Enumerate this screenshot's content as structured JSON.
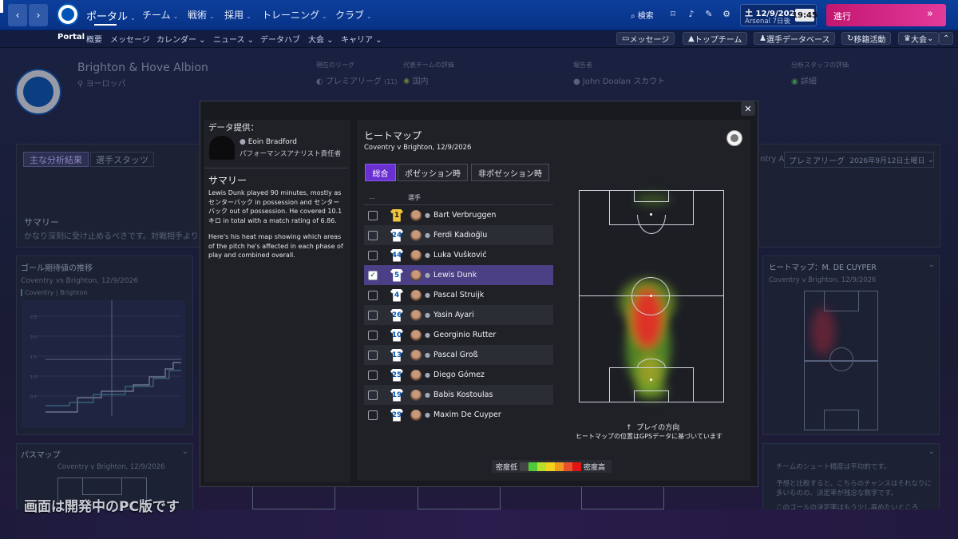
{
  "topbar": {
    "back_icon": "chevron-left",
    "forward_icon": "chevron-right",
    "nav": [
      "ポータル",
      "チーム",
      "戦術",
      "採用",
      "トレーニング",
      "クラブ"
    ],
    "search_label": "検索",
    "date": "土 12/9/2026",
    "next_match": "Arsenal 7日後",
    "time": "19:45",
    "continue_label": "進行",
    "continue_icon": "double-chevron-right"
  },
  "subnav": {
    "portal": "Portal",
    "items": [
      "概要",
      "メッセージ",
      "カレンダー",
      "ニュース",
      "データハブ",
      "大会",
      "キャリア"
    ],
    "right_buttons": [
      "メッセージ",
      "トップチーム",
      "選手データベース",
      "移籍活動",
      "大会"
    ]
  },
  "club": {
    "name": "Brighton & Hove Albion",
    "region": "ヨーロッパ",
    "current_league_label": "現在のリーグ",
    "current_league": "プレミアリーグ",
    "league_rank": "(11)",
    "rep_label": "代表チームの評価",
    "rep_value": "国内",
    "reporter_label": "報告者",
    "reporter": "John Doolan スカウト",
    "analyst_eval_label": "分析スタッフの評価",
    "analyst_eval": "詳細"
  },
  "background": {
    "tabs": [
      "主な分析結果",
      "選手スタッツ"
    ],
    "summary_title": "サマリー",
    "summary_text": "かなり深刻に受け止めるべきです。対戦相手より",
    "filter_left": "ntry A",
    "filter_league": "プレミアリーグ",
    "filter_date": "2026年9月12日土曜日",
    "xg_title": "ゴール期待値の推移",
    "xg_match": "Coventry vs Brighton, 12/9/2026",
    "xg_legend": [
      "Coventry",
      "Brighton"
    ],
    "pass_title": "パスマップ",
    "pass_match": "Coventry v Brighton, 12/9/2026",
    "right_heat_title": "ヒートマップ：M. DE CUYPER",
    "right_heat_match": "Coventry v Brighton, 12/9/2026",
    "shot_text1": "チームのシュート精度は平均的です。",
    "shot_text2": "予想と比較すると、こちらのチャンスはそれなりに多いものの、決定率が残念な数字です。",
    "shot_text3": "このゴールの決定率はもう少し高めたいところ",
    "watermark": "画面は開発中のPC版です"
  },
  "modal": {
    "provider_label": "データ提供：",
    "analyst_name": "Eoin Bradford",
    "analyst_role": "パフォーマンスアナリスト責任者",
    "summary_title": "サマリー",
    "summary_p1": "Lewis Dunk played 90 minutes, mostly as センターバック in possession and センターバック out of possession. He covered 10.1キロ in total with a match rating of 6.86.",
    "summary_p2": "Here's his heat map showing which areas of the pitch he's affected in each phase of play and combined overall.",
    "heatmap_title": "ヒートマップ",
    "match": "Coventry v Brighton, 12/9/2026",
    "tabs": [
      "総合",
      "ポゼッション時",
      "非ポゼッション時"
    ],
    "col_more": "...",
    "col_player": "選手",
    "players": [
      {
        "number": "1",
        "name": "Bart Verbruggen",
        "checked": false,
        "gk": true
      },
      {
        "number": "24",
        "name": "Ferdi Kadıoğlu",
        "checked": false
      },
      {
        "number": "44",
        "name": "Luka Vušković",
        "checked": false
      },
      {
        "number": "5",
        "name": "Lewis Dunk",
        "checked": true
      },
      {
        "number": "4",
        "name": "Pascal Struijk",
        "checked": false
      },
      {
        "number": "26",
        "name": "Yasin Ayari",
        "checked": false
      },
      {
        "number": "10",
        "name": "Georginio Rutter",
        "checked": false
      },
      {
        "number": "13",
        "name": "Pascal Groß",
        "checked": false
      },
      {
        "number": "25",
        "name": "Diego Gómez",
        "checked": false
      },
      {
        "number": "19",
        "name": "Babis Kostoulas",
        "checked": false
      },
      {
        "number": "29",
        "name": "Maxim De Cuyper",
        "checked": false
      }
    ],
    "direction_label": "プレイの方向",
    "gps_note": "ヒートマップの位置はGPSデータに基づいています",
    "density_low": "密度低",
    "density_high": "密度高",
    "density_colors": [
      "#444444",
      "#4fc93a",
      "#b6e02c",
      "#f2d21d",
      "#f09a1e",
      "#e8512b",
      "#e21414"
    ],
    "close_icon": "close-x"
  }
}
